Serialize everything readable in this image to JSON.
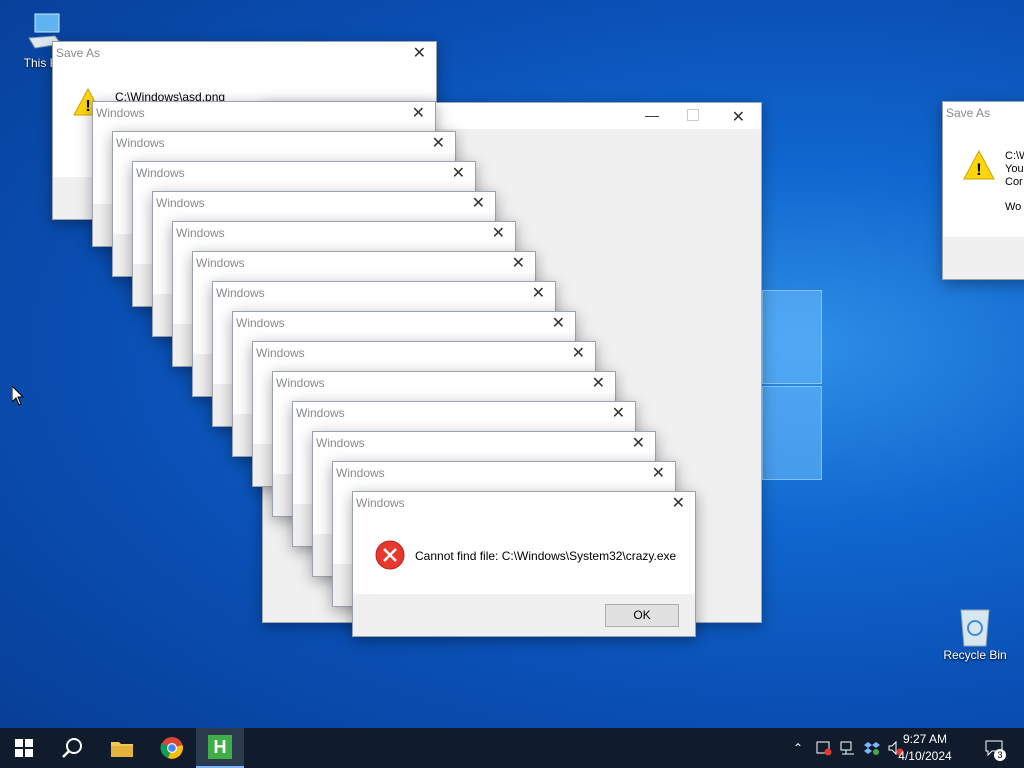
{
  "desktop": {
    "icons": [
      {
        "label": "This PC"
      },
      {
        "label": "Recycle Bin"
      }
    ]
  },
  "save_as_left": {
    "title": "Save As",
    "path": "C:\\Windows\\asd.png"
  },
  "save_as_right": {
    "title": "Save As",
    "line1": "C:\\W",
    "line2": "You",
    "line3": "Cor",
    "line4": "Wo"
  },
  "windows_dialogs": {
    "title": "Windows",
    "message": "Cannot find file: C:\\Windows\\System32\\crazy.exe",
    "ok_label": "OK"
  },
  "taskbar": {
    "time": "9:27 AM",
    "date": "4/10/2024",
    "notification_count": "3"
  }
}
